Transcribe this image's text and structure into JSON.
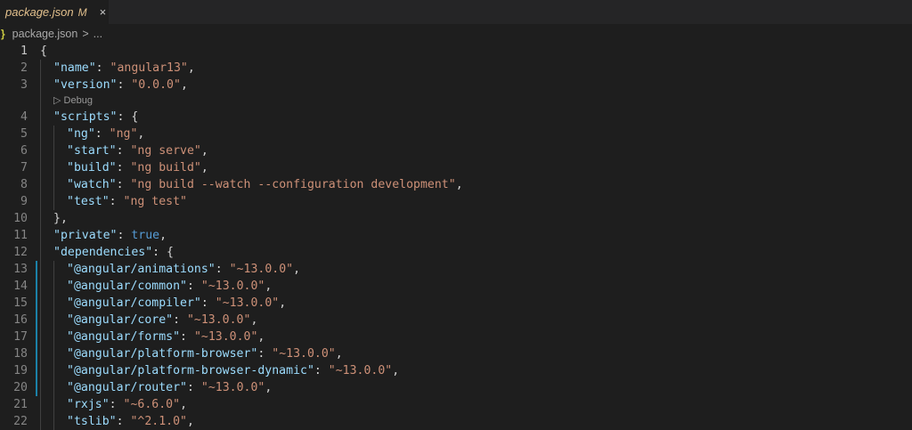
{
  "tab": {
    "filename": "package.json",
    "badge": "M",
    "close": "×"
  },
  "breadcrumb": {
    "icon": "}",
    "file": "package.json",
    "separator": ">",
    "more": "..."
  },
  "codelens": {
    "label": "Debug"
  },
  "lines": [
    {
      "n": "1",
      "indent": 0,
      "tokens": [
        {
          "t": "{",
          "c": "p"
        }
      ]
    },
    {
      "n": "2",
      "indent": 1,
      "tokens": [
        {
          "t": "\"name\"",
          "c": "k"
        },
        {
          "t": ": ",
          "c": "p"
        },
        {
          "t": "\"angular13\"",
          "c": "s"
        },
        {
          "t": ",",
          "c": "p"
        }
      ]
    },
    {
      "n": "3",
      "indent": 1,
      "tokens": [
        {
          "t": "\"version\"",
          "c": "k"
        },
        {
          "t": ": ",
          "c": "p"
        },
        {
          "t": "\"0.0.0\"",
          "c": "s"
        },
        {
          "t": ",",
          "c": "p"
        }
      ]
    },
    {
      "n": "4",
      "indent": 1,
      "tokens": [
        {
          "t": "\"scripts\"",
          "c": "k"
        },
        {
          "t": ": {",
          "c": "p"
        }
      ]
    },
    {
      "n": "5",
      "indent": 2,
      "tokens": [
        {
          "t": "\"ng\"",
          "c": "k"
        },
        {
          "t": ": ",
          "c": "p"
        },
        {
          "t": "\"ng\"",
          "c": "s"
        },
        {
          "t": ",",
          "c": "p"
        }
      ]
    },
    {
      "n": "6",
      "indent": 2,
      "tokens": [
        {
          "t": "\"start\"",
          "c": "k"
        },
        {
          "t": ": ",
          "c": "p"
        },
        {
          "t": "\"ng serve\"",
          "c": "s"
        },
        {
          "t": ",",
          "c": "p"
        }
      ]
    },
    {
      "n": "7",
      "indent": 2,
      "tokens": [
        {
          "t": "\"build\"",
          "c": "k"
        },
        {
          "t": ": ",
          "c": "p"
        },
        {
          "t": "\"ng build\"",
          "c": "s"
        },
        {
          "t": ",",
          "c": "p"
        }
      ]
    },
    {
      "n": "8",
      "indent": 2,
      "tokens": [
        {
          "t": "\"watch\"",
          "c": "k"
        },
        {
          "t": ": ",
          "c": "p"
        },
        {
          "t": "\"ng build --watch --configuration development\"",
          "c": "s"
        },
        {
          "t": ",",
          "c": "p"
        }
      ]
    },
    {
      "n": "9",
      "indent": 2,
      "tokens": [
        {
          "t": "\"test\"",
          "c": "k"
        },
        {
          "t": ": ",
          "c": "p"
        },
        {
          "t": "\"ng test\"",
          "c": "s"
        }
      ]
    },
    {
      "n": "10",
      "indent": 1,
      "tokens": [
        {
          "t": "},",
          "c": "p"
        }
      ]
    },
    {
      "n": "11",
      "indent": 1,
      "tokens": [
        {
          "t": "\"private\"",
          "c": "k"
        },
        {
          "t": ": ",
          "c": "p"
        },
        {
          "t": "true",
          "c": "b"
        },
        {
          "t": ",",
          "c": "p"
        }
      ]
    },
    {
      "n": "12",
      "indent": 1,
      "tokens": [
        {
          "t": "\"dependencies\"",
          "c": "k"
        },
        {
          "t": ": {",
          "c": "p"
        }
      ]
    },
    {
      "n": "13",
      "indent": 2,
      "modified": true,
      "tokens": [
        {
          "t": "\"@angular/animations\"",
          "c": "k"
        },
        {
          "t": ": ",
          "c": "p"
        },
        {
          "t": "\"~13.0.0\"",
          "c": "s"
        },
        {
          "t": ",",
          "c": "p"
        }
      ]
    },
    {
      "n": "14",
      "indent": 2,
      "modified": true,
      "tokens": [
        {
          "t": "\"@angular/common\"",
          "c": "k"
        },
        {
          "t": ": ",
          "c": "p"
        },
        {
          "t": "\"~13.0.0\"",
          "c": "s"
        },
        {
          "t": ",",
          "c": "p"
        }
      ]
    },
    {
      "n": "15",
      "indent": 2,
      "modified": true,
      "tokens": [
        {
          "t": "\"@angular/compiler\"",
          "c": "k"
        },
        {
          "t": ": ",
          "c": "p"
        },
        {
          "t": "\"~13.0.0\"",
          "c": "s"
        },
        {
          "t": ",",
          "c": "p"
        }
      ]
    },
    {
      "n": "16",
      "indent": 2,
      "modified": true,
      "tokens": [
        {
          "t": "\"@angular/core\"",
          "c": "k"
        },
        {
          "t": ": ",
          "c": "p"
        },
        {
          "t": "\"~13.0.0\"",
          "c": "s"
        },
        {
          "t": ",",
          "c": "p"
        }
      ]
    },
    {
      "n": "17",
      "indent": 2,
      "modified": true,
      "tokens": [
        {
          "t": "\"@angular/forms\"",
          "c": "k"
        },
        {
          "t": ": ",
          "c": "p"
        },
        {
          "t": "\"~13.0.0\"",
          "c": "s"
        },
        {
          "t": ",",
          "c": "p"
        }
      ]
    },
    {
      "n": "18",
      "indent": 2,
      "modified": true,
      "tokens": [
        {
          "t": "\"@angular/platform-browser\"",
          "c": "k"
        },
        {
          "t": ": ",
          "c": "p"
        },
        {
          "t": "\"~13.0.0\"",
          "c": "s"
        },
        {
          "t": ",",
          "c": "p"
        }
      ]
    },
    {
      "n": "19",
      "indent": 2,
      "modified": true,
      "tokens": [
        {
          "t": "\"@angular/platform-browser-dynamic\"",
          "c": "k"
        },
        {
          "t": ": ",
          "c": "p"
        },
        {
          "t": "\"~13.0.0\"",
          "c": "s"
        },
        {
          "t": ",",
          "c": "p"
        }
      ]
    },
    {
      "n": "20",
      "indent": 2,
      "modified": true,
      "tokens": [
        {
          "t": "\"@angular/router\"",
          "c": "k"
        },
        {
          "t": ": ",
          "c": "p"
        },
        {
          "t": "\"~13.0.0\"",
          "c": "s"
        },
        {
          "t": ",",
          "c": "p"
        }
      ]
    },
    {
      "n": "21",
      "indent": 2,
      "tokens": [
        {
          "t": "\"rxjs\"",
          "c": "k"
        },
        {
          "t": ": ",
          "c": "p"
        },
        {
          "t": "\"~6.6.0\"",
          "c": "s"
        },
        {
          "t": ",",
          "c": "p"
        }
      ]
    },
    {
      "n": "22",
      "indent": 2,
      "tokens": [
        {
          "t": "\"tslib\"",
          "c": "k"
        },
        {
          "t": ": ",
          "c": "p"
        },
        {
          "t": "\"^2.1.0\"",
          "c": "s"
        },
        {
          "t": ",",
          "c": "p"
        }
      ]
    }
  ]
}
